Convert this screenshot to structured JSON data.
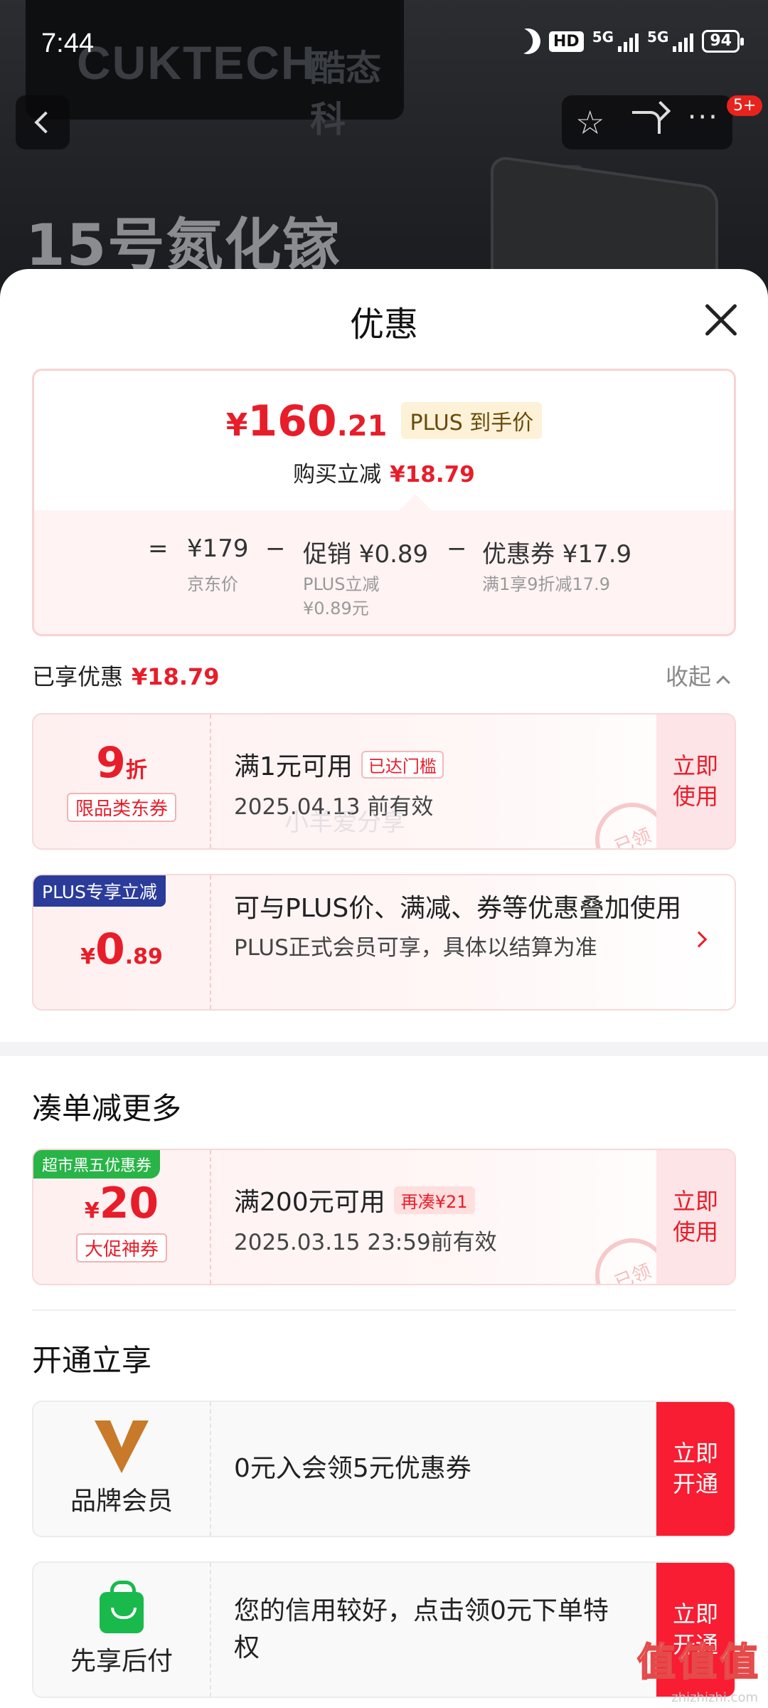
{
  "status_bar": {
    "time": "7:44",
    "hd": "HD",
    "net1": "5G",
    "net2": "5G",
    "battery": "94"
  },
  "background_page": {
    "brand": "CUKTECH",
    "brand_cn": "酷态科",
    "headline": "15号氮化镓",
    "more_badge": "5+",
    "star_icon": "☆",
    "more_icon": "···"
  },
  "sheet": {
    "title": "优惠",
    "summary": {
      "currency": "¥",
      "price_int": "160",
      "price_dec": ".21",
      "plus_label": "PLUS 到手价",
      "instant_label": "购买立减",
      "instant_value": "¥18.79",
      "eq": "=",
      "minus": "−",
      "jd_price": "¥179",
      "jd_label": "京东价",
      "promo_label": "促销 ¥0.89",
      "promo_sub1": "PLUS立减",
      "promo_sub2": "¥0.89元",
      "coupon_label": "优惠券 ¥17.9",
      "coupon_sub": "满1享9折减17.9"
    },
    "enjoyed_label": "已享优惠",
    "enjoyed_value": "¥18.79",
    "collapse_label": "收起",
    "coupons": [
      {
        "num": "9",
        "unit": "折",
        "kind": "限品类东券",
        "condition": "满1元可用",
        "tag": "已达门槛",
        "validity": "2025.04.13 前有效",
        "action": "立即使用",
        "stamp": "已领"
      }
    ],
    "plus_deal": {
      "label": "PLUS专享立减",
      "currency": "¥",
      "amount_int": "0",
      "amount_dec": ".89",
      "line1": "可与PLUS价、满减、券等优惠叠加使用",
      "line2": "PLUS正式会员可享，具体以结算为准"
    },
    "more_section_title": "凑单减更多",
    "more_coupon": {
      "ribbon": "超市黑五优惠券",
      "currency": "¥",
      "amount": "20",
      "kind": "大促神券",
      "condition": "满200元可用",
      "tag": "再凑¥21",
      "validity": "2025.03.15 23:59前有效",
      "action": "立即使用",
      "stamp": "已领"
    },
    "open_section_title": "开通立享",
    "memberships": [
      {
        "name": "品牌会员",
        "desc": "0元入会领5元优惠券",
        "action": "立即开通"
      },
      {
        "name": "先享后付",
        "desc": "您的信用较好，点击领0元下单特权",
        "action": "立即开通"
      }
    ],
    "watermark": "小羊爱分享",
    "corner_logo": "值值值",
    "corner_url": "zhizhizhi.com"
  }
}
